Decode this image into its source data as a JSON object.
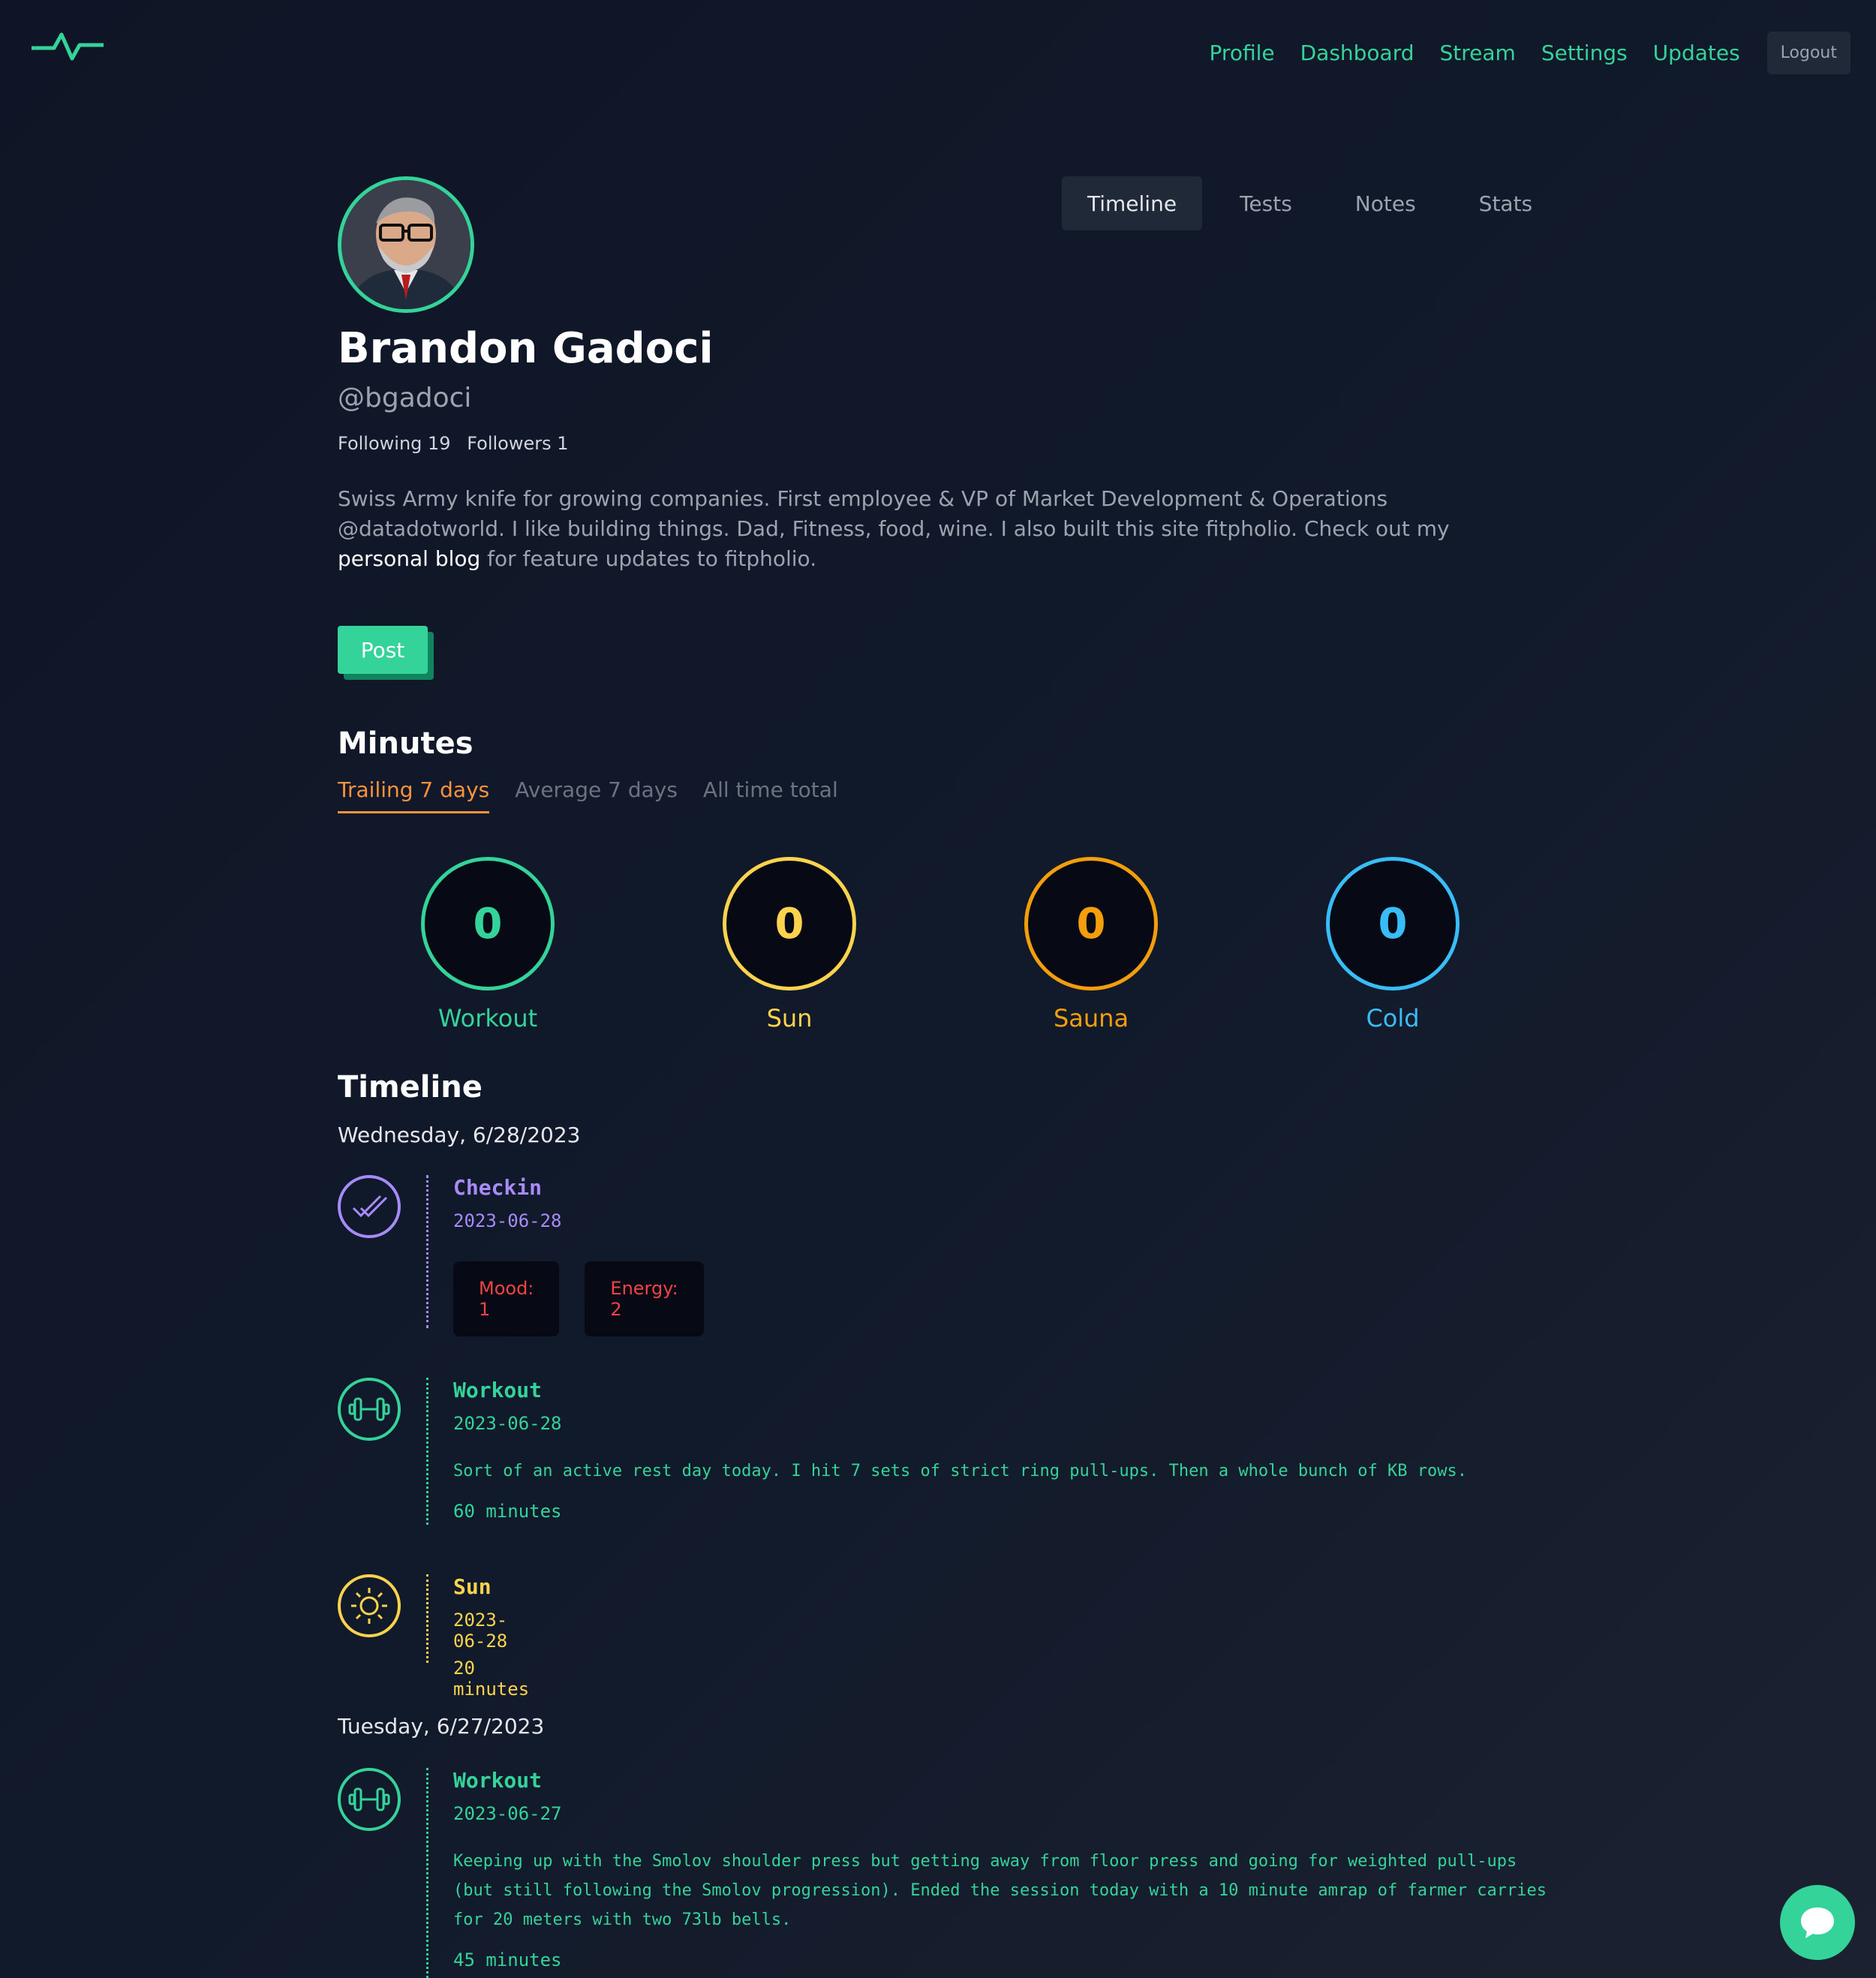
{
  "nav": {
    "links": [
      "Profile",
      "Dashboard",
      "Stream",
      "Settings",
      "Updates"
    ],
    "logout": "Logout"
  },
  "profile": {
    "name": "Brandon Gadoci",
    "handle": "@bgadoci",
    "following": "Following 19",
    "followers": "Followers 1",
    "bio_before": "Swiss Army knife for growing companies. First employee & VP of Market Development & Operations @datadotworld. I like building things. Dad, Fitness, food, wine. I also built this site fitpholio. Check out my ",
    "bio_link": "personal blog",
    "bio_after": " for feature updates to fitpholio.",
    "post_button": "Post"
  },
  "tabs": [
    "Timeline",
    "Tests",
    "Notes",
    "Stats"
  ],
  "minutes": {
    "heading": "Minutes",
    "tabs": [
      "Trailing 7 days",
      "Average 7 days",
      "All time total"
    ],
    "stats": [
      {
        "label": "Workout",
        "value": "0",
        "color": "#34d399"
      },
      {
        "label": "Sun",
        "value": "0",
        "color": "#fcd34d"
      },
      {
        "label": "Sauna",
        "value": "0",
        "color": "#f59e0b"
      },
      {
        "label": "Cold",
        "value": "0",
        "color": "#38bdf8"
      }
    ]
  },
  "timeline": {
    "heading": "Timeline",
    "days": [
      {
        "date": "Wednesday, 6/28/2023",
        "entries": [
          {
            "type": "Checkin",
            "date": "2023-06-28",
            "icon": "check-double-icon",
            "color": "#a78bfa",
            "chips": [
              "Mood: 1",
              "Energy: 2"
            ]
          },
          {
            "type": "Workout",
            "date": "2023-06-28",
            "icon": "dumbbell-icon",
            "color": "#34d399",
            "description": "Sort of an active rest day today. I hit 7 sets of strict ring pull-ups. Then a whole bunch of KB rows.",
            "minutes": "60 minutes"
          },
          {
            "type": "Sun",
            "date": "2023-06-28",
            "icon": "sun-icon",
            "color": "#fcd34d",
            "minutes": "20 minutes"
          }
        ]
      },
      {
        "date": "Tuesday, 6/27/2023",
        "entries": [
          {
            "type": "Workout",
            "date": "2023-06-27",
            "icon": "dumbbell-icon",
            "color": "#34d399",
            "description": "Keeping up with the Smolov shoulder press but getting away from floor press and going for weighted pull-ups (but still following the Smolov progression). Ended the session today with a 10 minute amrap of farmer carries for 20 meters with two 73lb bells.",
            "minutes": "45 minutes"
          }
        ]
      }
    ]
  }
}
